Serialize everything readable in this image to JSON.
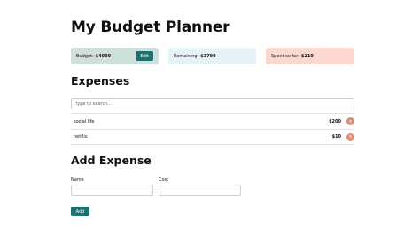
{
  "title": "My Budget Planner",
  "cards": {
    "budget": {
      "label": "Budget:",
      "value": "$4000",
      "edit_label": "Edit"
    },
    "remaining": {
      "label": "Remaining:",
      "value": "$3790"
    },
    "spent": {
      "label": "Spent so far:",
      "value": "$210"
    }
  },
  "expenses": {
    "heading": "Expenses",
    "search_placeholder": "Type to search...",
    "items": [
      {
        "name": "social life",
        "cost": "$200",
        "delete_glyph": "×"
      },
      {
        "name": "netflix",
        "cost": "$10",
        "delete_glyph": "×"
      }
    ]
  },
  "add_expense": {
    "heading": "Add Expense",
    "name_label": "Name",
    "name_value": "",
    "cost_label": "Cost",
    "cost_value": "",
    "button_label": "Add"
  },
  "colors": {
    "accent": "#1f6f6f",
    "budget_card": "#cfe0dc",
    "remaining_card": "#e6f3f4",
    "spent_card": "#fbd9cf",
    "delete_button": "#d98e72"
  }
}
